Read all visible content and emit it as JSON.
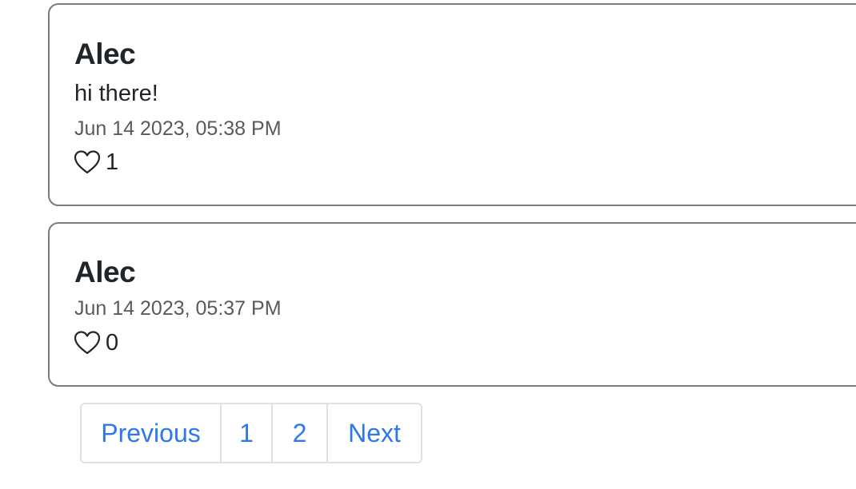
{
  "posts": [
    {
      "author": "Alec",
      "content": "hi there!",
      "timestamp": "Jun 14 2023, 05:38 PM",
      "likes": "1"
    },
    {
      "author": "Alec",
      "timestamp": "Jun 14 2023, 05:37 PM",
      "likes": "0"
    }
  ],
  "pagination": {
    "previous_label": "Previous",
    "pages": [
      "1",
      "2"
    ],
    "next_label": "Next"
  },
  "colors": {
    "link": "#2f78e8",
    "card_border": "#7a7a7a",
    "pagination_border": "#dee2e6"
  },
  "icons": {
    "like": "heart-outline-icon"
  }
}
